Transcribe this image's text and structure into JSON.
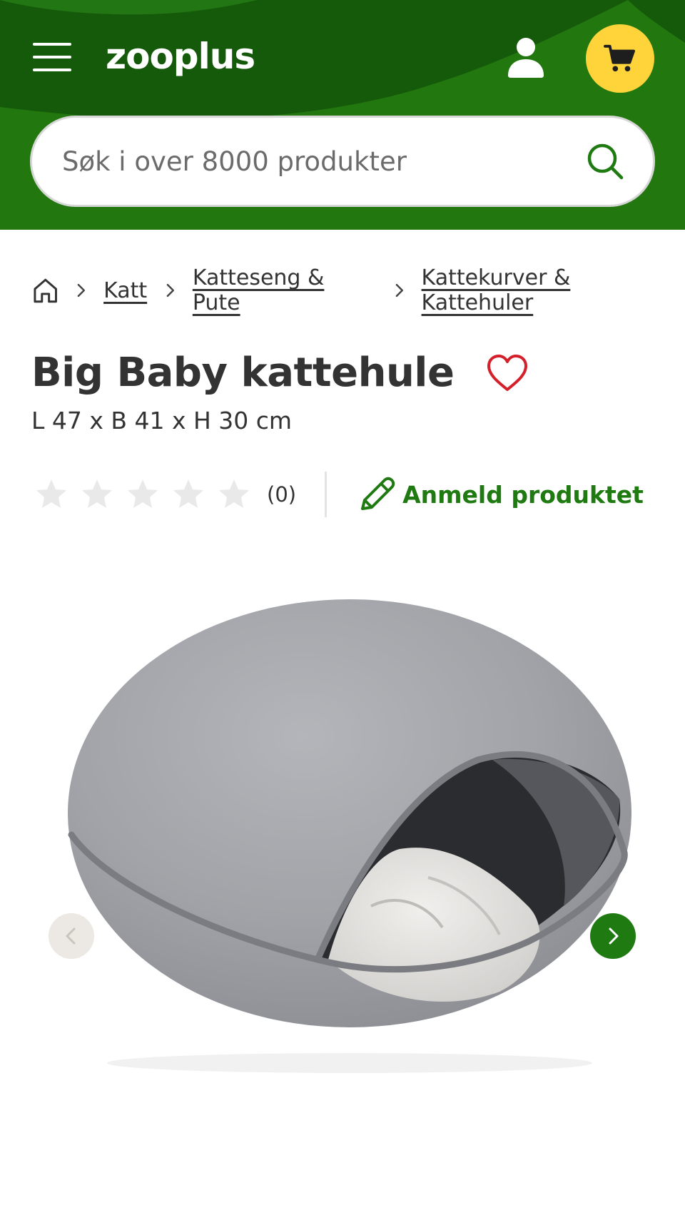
{
  "header": {
    "logo_text": "zooplus",
    "brand_color": "#22780f",
    "cart_color": "#ffd43b",
    "icons": [
      "menu-icon",
      "user-icon",
      "cart-icon",
      "search-icon"
    ]
  },
  "search": {
    "placeholder": "Søk i over 8000 produkter",
    "value": ""
  },
  "breadcrumb": {
    "items": [
      {
        "label": "Katt"
      },
      {
        "label": "Katteseng & Pute"
      },
      {
        "label": "Kattekurver & Kattehuler"
      }
    ]
  },
  "product": {
    "title": "Big Baby kattehule",
    "size": "L 47 x B 41 x H 30 cm",
    "rating_stars": 0,
    "rating_max": 5,
    "rating_count": "(0)",
    "review_label": "Anmeld produktet"
  },
  "gallery": {
    "image_name": "grey-felt-cat-cave-image"
  }
}
